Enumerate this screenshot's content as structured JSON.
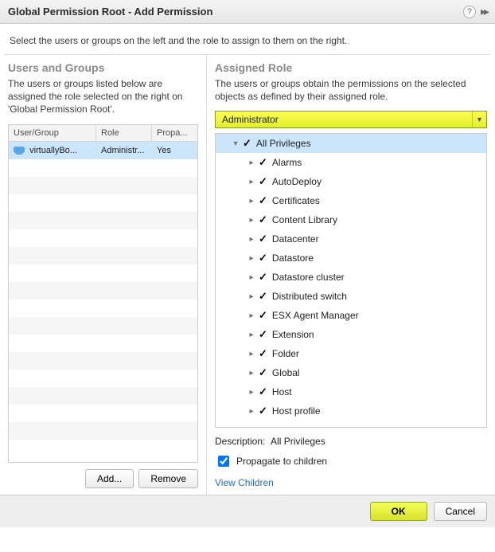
{
  "header": {
    "title": "Global Permission Root - Add Permission"
  },
  "intro": "Select the users or groups on the left and the role to assign to them on the right.",
  "left": {
    "title": "Users and Groups",
    "desc": "The users or groups listed below are assigned the role selected on the right on 'Global Permission Root'.",
    "columns": {
      "ug": "User/Group",
      "role": "Role",
      "prop": "Propa..."
    },
    "rows": [
      {
        "ug": "virtuallyBo...",
        "role": "Administr...",
        "prop": "Yes"
      }
    ],
    "add_label": "Add...",
    "remove_label": "Remove"
  },
  "right": {
    "title": "Assigned Role",
    "desc": "The users or groups obtain the permissions on the selected objects as defined by their assigned role.",
    "selected_role": "Administrator",
    "root_node": "All Privileges",
    "nodes": [
      "Alarms",
      "AutoDeploy",
      "Certificates",
      "Content Library",
      "Datacenter",
      "Datastore",
      "Datastore cluster",
      "Distributed switch",
      "ESX Agent Manager",
      "Extension",
      "Folder",
      "Global",
      "Host",
      "Host profile"
    ],
    "description_label": "Description:",
    "description_value": "All Privileges",
    "propagate_label": "Propagate to children",
    "view_children_label": "View Children"
  },
  "footer": {
    "ok": "OK",
    "cancel": "Cancel"
  }
}
